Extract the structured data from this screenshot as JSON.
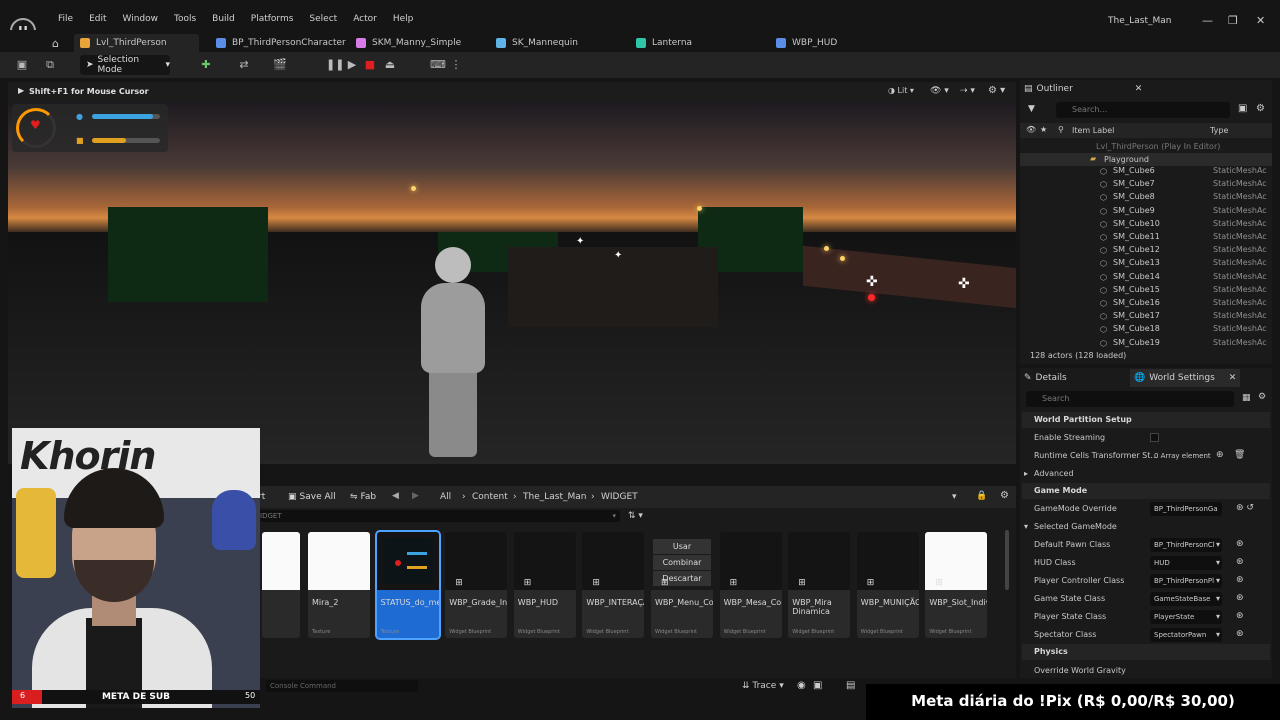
{
  "app": {
    "menu": [
      "File",
      "Edit",
      "Window",
      "Tools",
      "Build",
      "Platforms",
      "Select",
      "Actor",
      "Help"
    ],
    "project_title": "The_Last_Man",
    "logo_letter": "U"
  },
  "tabs": [
    {
      "label": "Lvl_ThirdPerson",
      "color": "#e8a33a"
    },
    {
      "label": "BP_ThirdPersonCharacter",
      "color": "#5b8de6"
    },
    {
      "label": "SKM_Manny_Simple",
      "color": "#d77be8"
    },
    {
      "label": "SK_Mannequin",
      "color": "#5fb3e6"
    },
    {
      "label": "Lanterna",
      "color": "#2fc6a8"
    },
    {
      "label": "WBP_HUD",
      "color": "#5b8de6"
    }
  ],
  "toolbar": {
    "mode_label": "Selection Mode"
  },
  "viewport": {
    "hint": "Shift+F1 for Mouse Cursor",
    "view_mode": "Lit"
  },
  "hud": {
    "health_fill": 0.9,
    "stamina_fill": 0.5,
    "health_color": "#3da3e0",
    "stamina_color": "#e0a020"
  },
  "outliner": {
    "title": "Outliner",
    "search_placeholder": "Search...",
    "col_label": "Item Label",
    "col_type": "Type",
    "root": "Lvl_ThirdPerson (Play In Editor)",
    "folder": "Playground",
    "items": [
      {
        "label": "SM_Cube6",
        "type": "StaticMeshAc"
      },
      {
        "label": "SM_Cube7",
        "type": "StaticMeshAc"
      },
      {
        "label": "SM_Cube8",
        "type": "StaticMeshAc"
      },
      {
        "label": "SM_Cube9",
        "type": "StaticMeshAc"
      },
      {
        "label": "SM_Cube10",
        "type": "StaticMeshAc"
      },
      {
        "label": "SM_Cube11",
        "type": "StaticMeshAc"
      },
      {
        "label": "SM_Cube12",
        "type": "StaticMeshAc"
      },
      {
        "label": "SM_Cube13",
        "type": "StaticMeshAc"
      },
      {
        "label": "SM_Cube14",
        "type": "StaticMeshAc"
      },
      {
        "label": "SM_Cube15",
        "type": "StaticMeshAc"
      },
      {
        "label": "SM_Cube16",
        "type": "StaticMeshAc"
      },
      {
        "label": "SM_Cube17",
        "type": "StaticMeshAc"
      },
      {
        "label": "SM_Cube18",
        "type": "StaticMeshAc"
      },
      {
        "label": "SM_Cube19",
        "type": "StaticMeshAc"
      }
    ],
    "count": "128 actors (128 loaded)"
  },
  "details": {
    "tab1": "Details",
    "tab2": "World Settings",
    "search_placeholder": "Search",
    "sections": {
      "world_partition": "World Partition Setup",
      "advanced": "Advanced",
      "game_mode": "Game Mode",
      "selected_gamemode": "Selected GameMode",
      "physics": "Physics"
    },
    "enable_streaming": "Enable Streaming",
    "runtime_cells": "Runtime Cells Transformer St...",
    "runtime_cells_value": "0 Array element",
    "gamemode_override": "GameMode Override",
    "gamemode_override_value": "BP_ThirdPersonGa",
    "rows": [
      {
        "label": "Default Pawn Class",
        "value": "BP_ThirdPersonCl"
      },
      {
        "label": "HUD Class",
        "value": "HUD"
      },
      {
        "label": "Player Controller Class",
        "value": "BP_ThirdPersonPl"
      },
      {
        "label": "Game State Class",
        "value": "GameStateBase"
      },
      {
        "label": "Player State Class",
        "value": "PlayerState"
      },
      {
        "label": "Spectator Class",
        "value": "SpectatorPawn"
      }
    ],
    "override_gravity": "Override World Gravity"
  },
  "content_browser": {
    "partial_label": "rt",
    "save_all": "Save All",
    "fab": "Fab",
    "breadcrumbs": [
      "All",
      "Content",
      "The_Last_Man",
      "WIDGET"
    ],
    "search_partial": "IDGET",
    "assets": [
      {
        "name": "",
        "type": ""
      },
      {
        "name": "Mira_2",
        "type": "Texture"
      },
      {
        "name": "STATUS_do_meu_jogo",
        "type": "Texture"
      },
      {
        "name": "WBP_Grade_Inventario",
        "type": "Widget Blueprint"
      },
      {
        "name": "WBP_HUD",
        "type": "Widget Blueprint"
      },
      {
        "name": "WBP_INTERAÇÃO",
        "type": "Widget Blueprint"
      },
      {
        "name": "WBP_Menu_Contexto",
        "type": "Widget Blueprint"
      },
      {
        "name": "WBP_Mesa_Combinação",
        "type": "Widget Blueprint"
      },
      {
        "name": "WBP_Mira Dinamica",
        "type": "Widget Blueprint"
      },
      {
        "name": "WBP_MUNIÇÃO_PISTOLA",
        "type": "Widget Blueprint"
      },
      {
        "name": "WBP_Slot_Individual",
        "type": "Widget Blueprint"
      }
    ],
    "menu_preview": [
      "Usar",
      "Combinar",
      "Descartar"
    ]
  },
  "statusbar": {
    "console_placeholder": "Console Command",
    "trace": "Trace"
  },
  "overlay": {
    "pix_goal": "Meta diária do !Pix (R$ 0,00/R$ 30,00)",
    "sub_goal_label": "META DE SUB",
    "sub_goal_current": "6",
    "sub_goal_target": "50",
    "banner_text": "Khorin"
  }
}
